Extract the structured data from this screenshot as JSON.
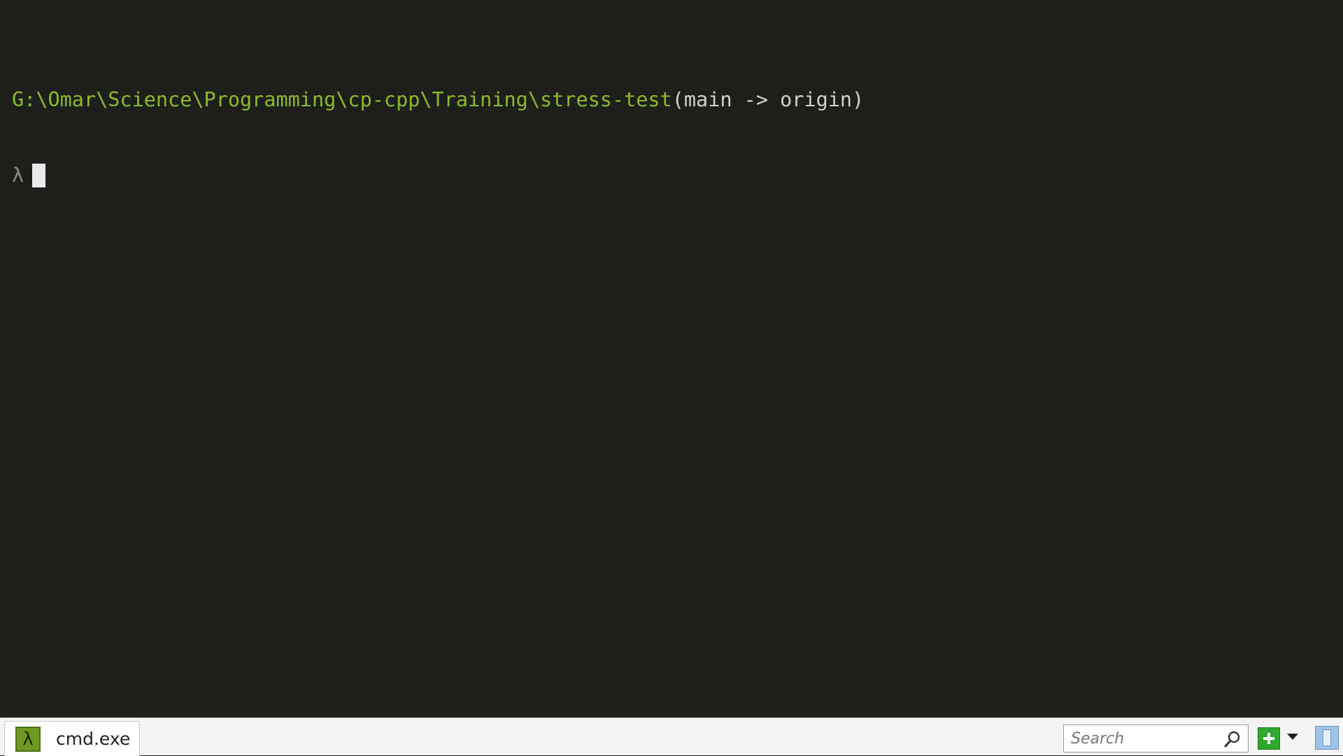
{
  "terminal": {
    "path": "G:\\Omar\\Science\\Programming\\cp-cpp\\Training\\stress-test",
    "branch_info": "(main -> origin)",
    "prompt_symbol": "λ"
  },
  "tabbar": {
    "tab_label": "cmd.exe",
    "tab_icon": "lambda-icon",
    "search_placeholder": "Search",
    "search_icon": "magnifier-icon",
    "add_icon": "plus-icon",
    "dropdown_icon": "chevron-down-icon",
    "panel_icon": "split-panel-icon"
  },
  "colors": {
    "background": "#1e1e1b",
    "path": "#8bbb2a",
    "tab_icon": "#6f9a22"
  }
}
